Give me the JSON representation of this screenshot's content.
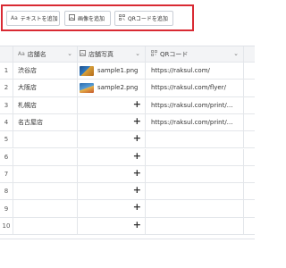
{
  "toolbar": {
    "add_text": {
      "icon": "Aa",
      "label": "テキストを追加"
    },
    "add_image": {
      "icon": "image-icon",
      "label": "画像を追加"
    },
    "add_qr": {
      "icon": "qr-icon",
      "label": "QRコードを追加"
    },
    "highlight_color": "#d92a33"
  },
  "table": {
    "headers": {
      "name": {
        "icon": "Aa",
        "label": "店舗名"
      },
      "photo": {
        "icon": "image-icon",
        "label": "店舗写真"
      },
      "qr": {
        "icon": "qr-icon",
        "label": "QRコード"
      }
    },
    "rows": [
      {
        "index": "1",
        "name": "渋谷店",
        "photo": "sample1.png",
        "qr": "https://raksul.com/"
      },
      {
        "index": "2",
        "name": "大阪店",
        "photo": "sample2.png",
        "qr": "https://raksul.com/flyer/"
      },
      {
        "index": "3",
        "name": "札幌店",
        "photo": "",
        "qr": "https://raksul.com/print/…"
      },
      {
        "index": "4",
        "name": "名古屋店",
        "photo": "",
        "qr": "https://raksul.com/print/…"
      },
      {
        "index": "5",
        "name": "",
        "photo": "",
        "qr": ""
      },
      {
        "index": "6",
        "name": "",
        "photo": "",
        "qr": ""
      },
      {
        "index": "7",
        "name": "",
        "photo": "",
        "qr": ""
      },
      {
        "index": "8",
        "name": "",
        "photo": "",
        "qr": ""
      },
      {
        "index": "9",
        "name": "",
        "photo": "",
        "qr": ""
      },
      {
        "index": "10",
        "name": "",
        "photo": "",
        "qr": ""
      }
    ],
    "add_image_symbol": "+"
  }
}
